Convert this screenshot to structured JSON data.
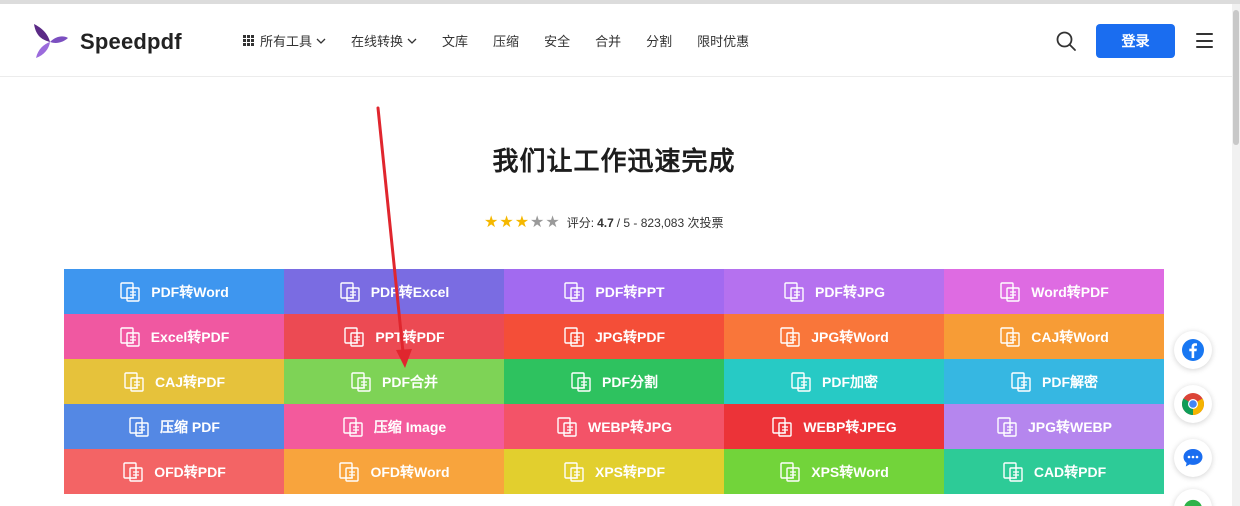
{
  "brand": {
    "name": "Speedpdf"
  },
  "nav": {
    "items": [
      {
        "label": "所有工具",
        "has_grid_icon": true,
        "has_dropdown": true
      },
      {
        "label": "在线转换",
        "has_grid_icon": false,
        "has_dropdown": true
      },
      {
        "label": "文库"
      },
      {
        "label": "压缩"
      },
      {
        "label": "安全"
      },
      {
        "label": "合并"
      },
      {
        "label": "分割"
      },
      {
        "label": "限时优惠"
      }
    ],
    "login_label": "登录"
  },
  "hero": {
    "title": "我们让工作迅速完成",
    "rating": {
      "stars_filled": 3,
      "stars_total": 5,
      "prefix": "评分:",
      "score": "4.7",
      "suffix": "/ 5 - 823,083 次投票"
    }
  },
  "tools": [
    {
      "label": "PDF转Word",
      "color": "#3e96ef"
    },
    {
      "label": "PDF转Excel",
      "color": "#7a6ce2"
    },
    {
      "label": "PDF转PPT",
      "color": "#a26af0"
    },
    {
      "label": "PDF转JPG",
      "color": "#b571ef"
    },
    {
      "label": "Word转PDF",
      "color": "#de6be2"
    },
    {
      "label": "Excel转PDF",
      "color": "#f058a1"
    },
    {
      "label": "PPT转PDF",
      "color": "#ec4a53"
    },
    {
      "label": "JPG转PDF",
      "color": "#f44e38"
    },
    {
      "label": "JPG转Word",
      "color": "#f9763a"
    },
    {
      "label": "CAJ转Word",
      "color": "#f79c36"
    },
    {
      "label": "CAJ转PDF",
      "color": "#e6c23b"
    },
    {
      "label": "PDF合并",
      "color": "#7ed356"
    },
    {
      "label": "PDF分割",
      "color": "#2ec25f"
    },
    {
      "label": "PDF加密",
      "color": "#27cac5"
    },
    {
      "label": "PDF解密",
      "color": "#36b7e2"
    },
    {
      "label": "压缩 PDF",
      "color": "#5488e4"
    },
    {
      "label": "压缩 Image",
      "color": "#f35a9c"
    },
    {
      "label": "WEBP转JPG",
      "color": "#f35368"
    },
    {
      "label": "WEBP转JPEG",
      "color": "#ec3338"
    },
    {
      "label": "JPG转WEBP",
      "color": "#b586ee"
    },
    {
      "label": "OFD转PDF",
      "color": "#f36465"
    },
    {
      "label": "OFD转Word",
      "color": "#f8a43d"
    },
    {
      "label": "XPS转PDF",
      "color": "#e2cf2e"
    },
    {
      "label": "XPS转Word",
      "color": "#72d43a"
    },
    {
      "label": "CAD转PDF",
      "color": "#2dcb97"
    }
  ],
  "side_buttons": [
    {
      "icon": "facebook-icon"
    },
    {
      "icon": "chrome-icon"
    },
    {
      "icon": "chat-icon"
    }
  ],
  "annotation": {
    "color": "#e0262e"
  }
}
